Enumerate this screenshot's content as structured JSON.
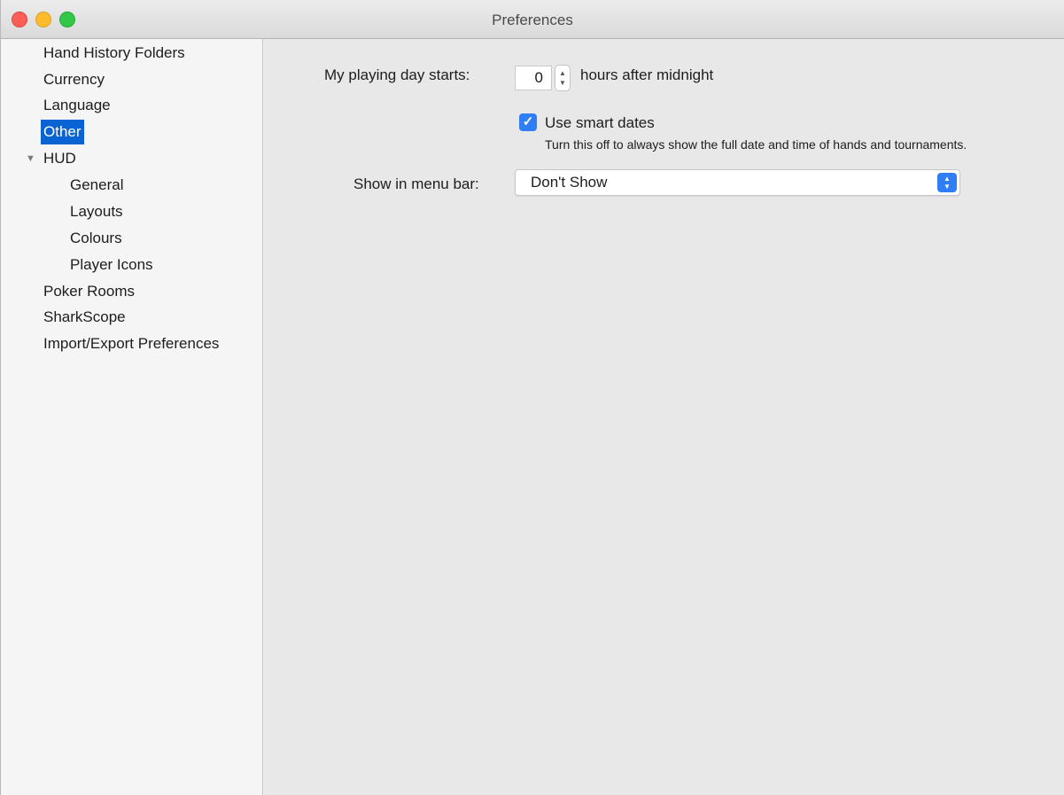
{
  "window": {
    "title": "Preferences"
  },
  "sidebar": {
    "items": [
      {
        "label": "Hand History Folders"
      },
      {
        "label": "Currency"
      },
      {
        "label": "Language"
      },
      {
        "label": "Other",
        "selected": true
      },
      {
        "label": "HUD",
        "expanded": true
      },
      {
        "label": "General"
      },
      {
        "label": "Layouts"
      },
      {
        "label": "Colours"
      },
      {
        "label": "Player Icons"
      },
      {
        "label": "Poker Rooms"
      },
      {
        "label": "SharkScope"
      },
      {
        "label": "Import/Export Preferences"
      }
    ]
  },
  "main": {
    "playing_day": {
      "label": "My playing day starts:",
      "value": "0",
      "suffix": "hours after midnight"
    },
    "smart_dates": {
      "checked": true,
      "label": "Use smart dates",
      "hint": "Turn this off to always show the full date and time of hands and tournaments."
    },
    "menu_bar": {
      "label": "Show in menu bar:",
      "selected": "Don't Show"
    }
  },
  "colors": {
    "selection": "#0a63d2",
    "accent": "#2f7ef5"
  }
}
